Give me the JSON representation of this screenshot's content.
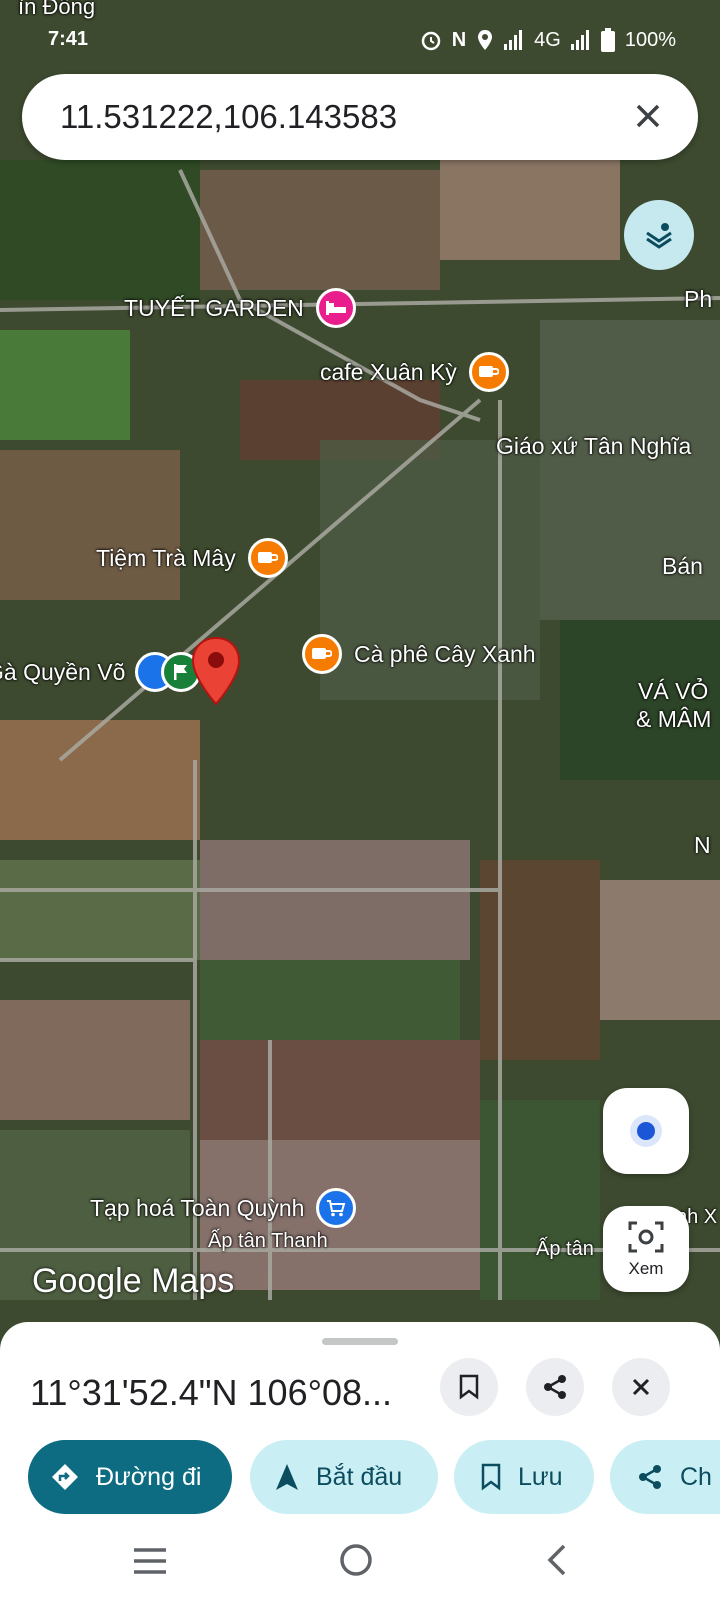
{
  "status": {
    "time": "7:41",
    "network": "4G",
    "battery": "100%",
    "top_label": "ìn Đồng"
  },
  "search": {
    "query": "11.531222,106.143583"
  },
  "map": {
    "pois": {
      "tuyet_garden": "TUYẾT GARDEN",
      "cafe_xuan_ky": "cafe Xuân Kỳ",
      "giao_xu": "Giáo xứ Tân Nghĩa",
      "tiem_tra_may": "Tiệm Trà Mây",
      "ca_phe_cay_xanh": "Cà phê Cây Xanh",
      "quyen_vo": "Gà Quyền Võ",
      "tap_hoa": "Tạp hoá Toàn Quỳnh"
    },
    "labels": {
      "ph": "Ph",
      "ban": "Bán",
      "va_vo": "VÁ VỎ",
      "mam": "& MÂM",
      "n": "N",
      "ap_tan_thanh": "Ấp tân Thanh",
      "ap_tan": "Ấp tân",
      "nh_x": "nh X"
    },
    "watermark": "Google Maps"
  },
  "controls": {
    "view_label": "Xem"
  },
  "sheet": {
    "coordinates": "11°31'52.4\"N 106°08...",
    "chips": {
      "directions": "Đường đi",
      "start": "Bắt đầu",
      "save": "Lưu",
      "share": "Ch"
    }
  },
  "colors": {
    "accent": "#0d6c82",
    "chip_bg": "#c9eff5",
    "pin_red": "#ea4335",
    "cafe_orange": "#f57c00",
    "hotel_pink": "#e91e8c",
    "shop_blue": "#1a73e8"
  }
}
